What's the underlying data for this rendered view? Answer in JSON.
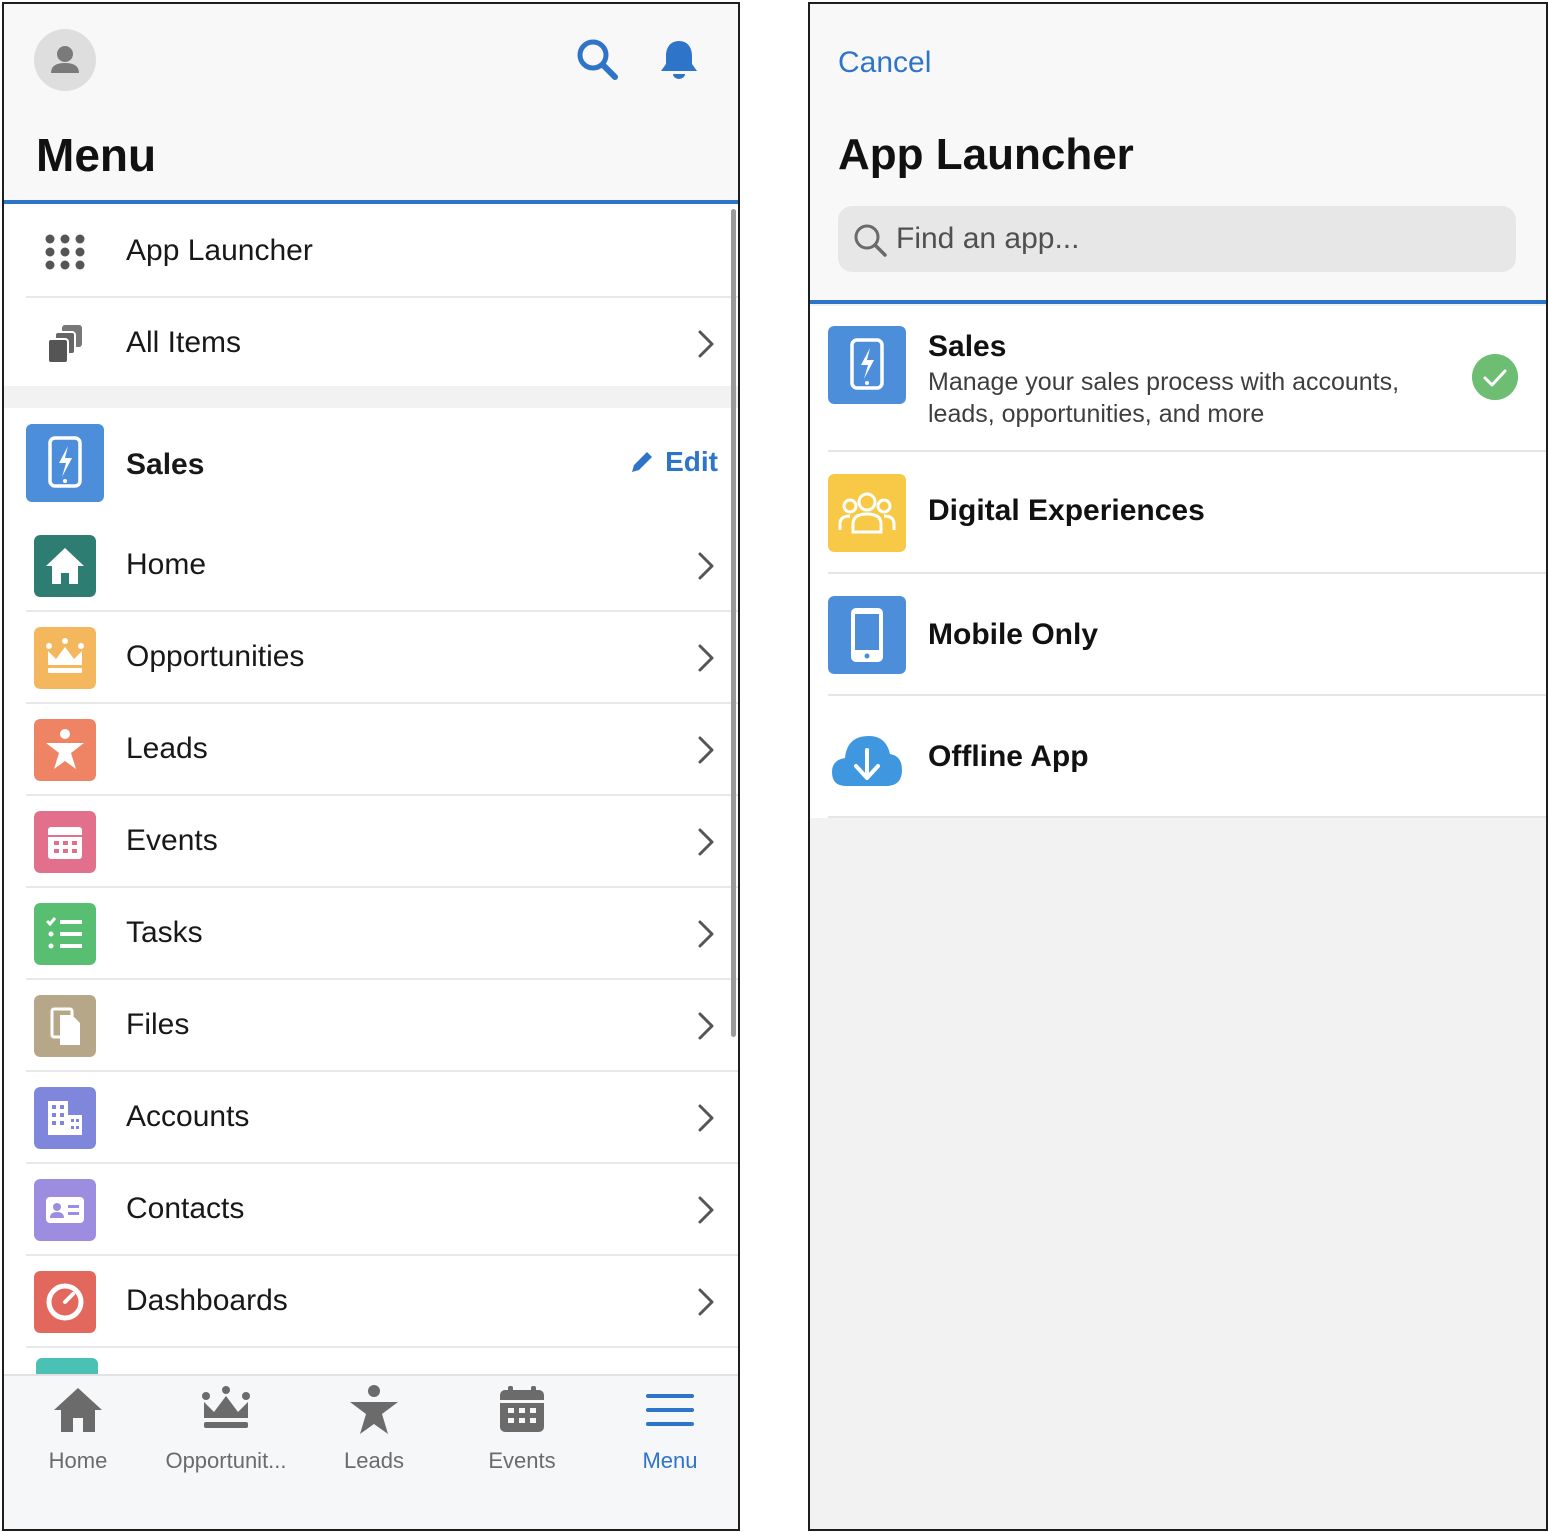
{
  "left": {
    "menu_title": "Menu",
    "top_items": [
      {
        "label": "App Launcher",
        "icon": "app-launcher-grid-icon",
        "has_chevron": false
      },
      {
        "label": "All Items",
        "icon": "all-items-stack-icon",
        "has_chevron": true
      }
    ],
    "app": {
      "name": "Sales",
      "edit_label": "Edit",
      "icon": "sales-app-icon",
      "color": "#4c8ed9"
    },
    "nav_items": [
      {
        "label": "Home",
        "icon": "home-icon",
        "color": "#2e7d73"
      },
      {
        "label": "Opportunities",
        "icon": "crown-icon",
        "color": "#f4b75e"
      },
      {
        "label": "Leads",
        "icon": "lead-star-person-icon",
        "color": "#ee8464"
      },
      {
        "label": "Events",
        "icon": "calendar-icon",
        "color": "#e2708d"
      },
      {
        "label": "Tasks",
        "icon": "task-list-icon",
        "color": "#58bf72"
      },
      {
        "label": "Files",
        "icon": "files-icon",
        "color": "#b7a789"
      },
      {
        "label": "Accounts",
        "icon": "building-icon",
        "color": "#7f87dd"
      },
      {
        "label": "Contacts",
        "icon": "contact-card-icon",
        "color": "#9d8de0"
      },
      {
        "label": "Dashboards",
        "icon": "gauge-icon",
        "color": "#e2675c"
      }
    ],
    "tabs": [
      {
        "label": "Home",
        "icon": "home-icon",
        "active": false
      },
      {
        "label": "Opportunit...",
        "icon": "crown-icon",
        "active": false
      },
      {
        "label": "Leads",
        "icon": "lead-star-person-icon",
        "active": false
      },
      {
        "label": "Events",
        "icon": "calendar-icon",
        "active": false
      },
      {
        "label": "Menu",
        "icon": "hamburger-menu-icon",
        "active": true
      }
    ]
  },
  "right": {
    "cancel_label": "Cancel",
    "title": "App Launcher",
    "search_placeholder": "Find an app...",
    "apps": [
      {
        "name": "Sales",
        "description": "Manage your sales process with accounts, leads, opportunities, and more",
        "icon": "sales-app-icon",
        "color": "#4c8ed9",
        "selected": true
      },
      {
        "name": "Digital Experiences",
        "description": "",
        "icon": "people-group-icon",
        "color": "#f7c947",
        "selected": false
      },
      {
        "name": "Mobile Only",
        "description": "",
        "icon": "mobile-phone-icon",
        "color": "#4c8ed9",
        "selected": false
      },
      {
        "name": "Offline App",
        "description": "",
        "icon": "cloud-download-icon",
        "color": "#3f97e0",
        "selected": false
      }
    ]
  },
  "colors": {
    "accent": "#2e74c9",
    "check": "#6dbe73"
  }
}
